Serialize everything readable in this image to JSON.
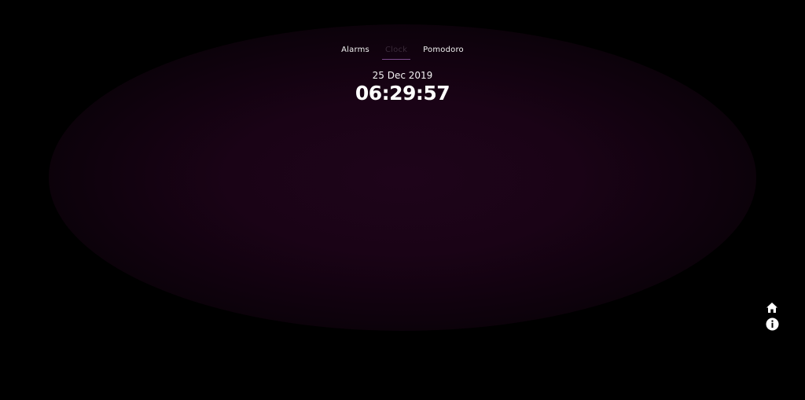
{
  "tabs": [
    {
      "label": "Alarms",
      "active": false
    },
    {
      "label": "Clock",
      "active": true
    },
    {
      "label": "Pomodoro",
      "active": false
    }
  ],
  "clock": {
    "date": "25 Dec 2019",
    "time": "06:29:57"
  },
  "side_icons": [
    "home-icon",
    "info-icon"
  ],
  "colors": {
    "background": "#000000",
    "glow": "#1e041a",
    "accent": "#7a4a8a",
    "text": "#ffffff"
  }
}
